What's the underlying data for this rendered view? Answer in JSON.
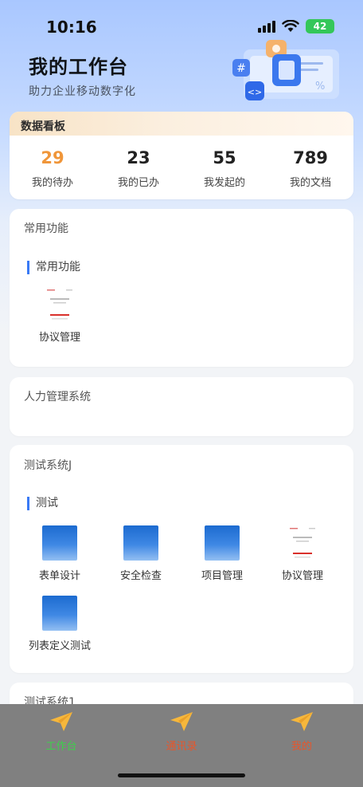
{
  "status_bar": {
    "time": "10:16",
    "battery": "42"
  },
  "header": {
    "title": "我的工作台",
    "subtitle": "助力企业移动数字化"
  },
  "data_board": {
    "title": "数据看板",
    "stats": [
      {
        "value": "29",
        "label": "我的待办"
      },
      {
        "value": "23",
        "label": "我的已办"
      },
      {
        "value": "55",
        "label": "我发起的"
      },
      {
        "value": "789",
        "label": "我的文档"
      }
    ]
  },
  "cards": {
    "common": {
      "title": "常用功能",
      "section": "常用功能",
      "apps": [
        {
          "label": "协议管理",
          "icon": "document-thumbnail-icon"
        }
      ]
    },
    "hr": {
      "title": "人力管理系统"
    },
    "test_j": {
      "title": "测试系统J",
      "section": "测试",
      "apps": [
        {
          "label": "表单设计",
          "icon": "blue-gradient-icon"
        },
        {
          "label": "安全检查",
          "icon": "blue-gradient-icon"
        },
        {
          "label": "项目管理",
          "icon": "blue-gradient-icon"
        },
        {
          "label": "协议管理",
          "icon": "document-thumbnail-icon"
        },
        {
          "label": "列表定义测试",
          "icon": "blue-gradient-icon"
        }
      ]
    },
    "test_1": {
      "title": "测试系统1"
    }
  },
  "tab_bar": {
    "items": [
      {
        "label": "工作台",
        "color": "#3ecf4b",
        "icon": "paper-plane-icon"
      },
      {
        "label": "通讯录",
        "color": "#e8552a",
        "icon": "paper-plane-icon"
      },
      {
        "label": "我的",
        "color": "#e8552a",
        "icon": "paper-plane-icon"
      }
    ],
    "background": "#808080"
  },
  "colors": {
    "accent": "#3a7af5",
    "highlight": "#f0963a"
  }
}
